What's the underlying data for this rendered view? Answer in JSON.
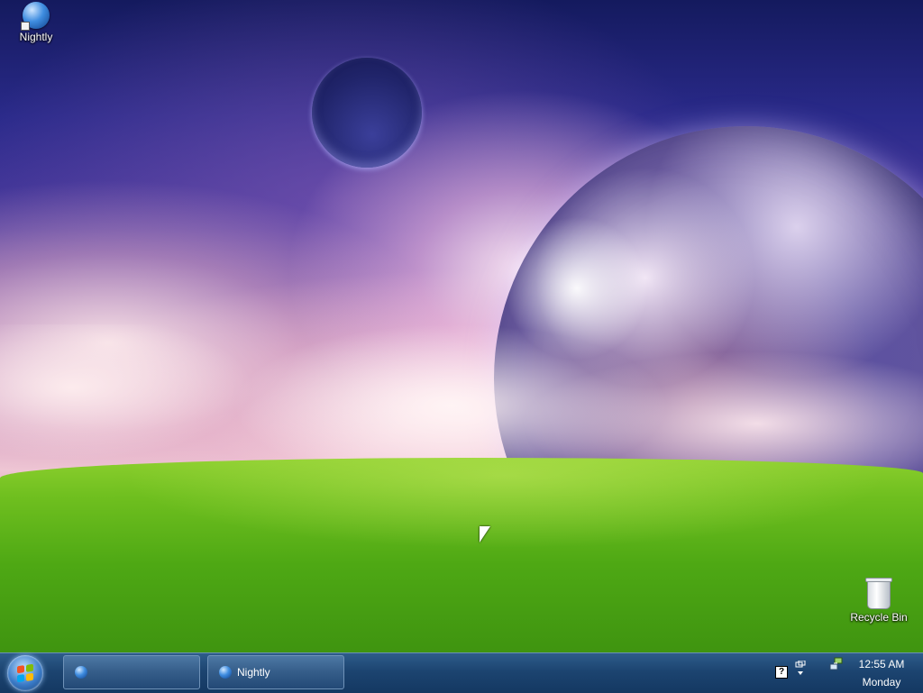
{
  "desktop": {
    "icons": [
      {
        "label": "Nightly",
        "icon": "firefox-nightly-globe-icon"
      },
      {
        "label": "Recycle Bin",
        "icon": "recycle-bin-icon"
      }
    ]
  },
  "taskbar": {
    "start_icon": "windows-start-orb-icon",
    "tasks": [
      {
        "label": ""
      },
      {
        "label": "Nightly"
      }
    ],
    "tray": {
      "help_glyph": "?",
      "icons": [
        "help-icon",
        "window-switcher-icon",
        "network-icon"
      ]
    },
    "clock": {
      "time": "12:55 AM",
      "day": "Monday"
    }
  },
  "colors": {
    "taskbar": "#1c4470",
    "grass": "#4ea814",
    "sky": "#2a2a8a"
  }
}
